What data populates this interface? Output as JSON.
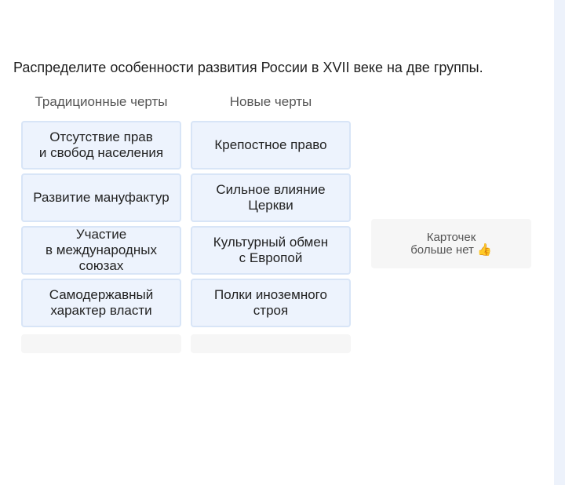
{
  "task": {
    "prompt": "Распределите особенности развития России в XVII веке на две группы."
  },
  "columns": [
    {
      "header": "Традиционные черты",
      "cards": [
        "Отсутствие прав\nи свобод населения",
        "Развитие мануфактур",
        "Участие\nв международных\nсоюзах",
        "Самодержавный\nхарактер власти"
      ]
    },
    {
      "header": "Новые черты",
      "cards": [
        "Крепостное право",
        "Сильное влияние\nЦеркви",
        "Культурный обмен\nс Европой",
        "Полки иноземного\nстроя"
      ]
    }
  ],
  "pool": {
    "text": "Карточек\nбольше нет 👍"
  }
}
